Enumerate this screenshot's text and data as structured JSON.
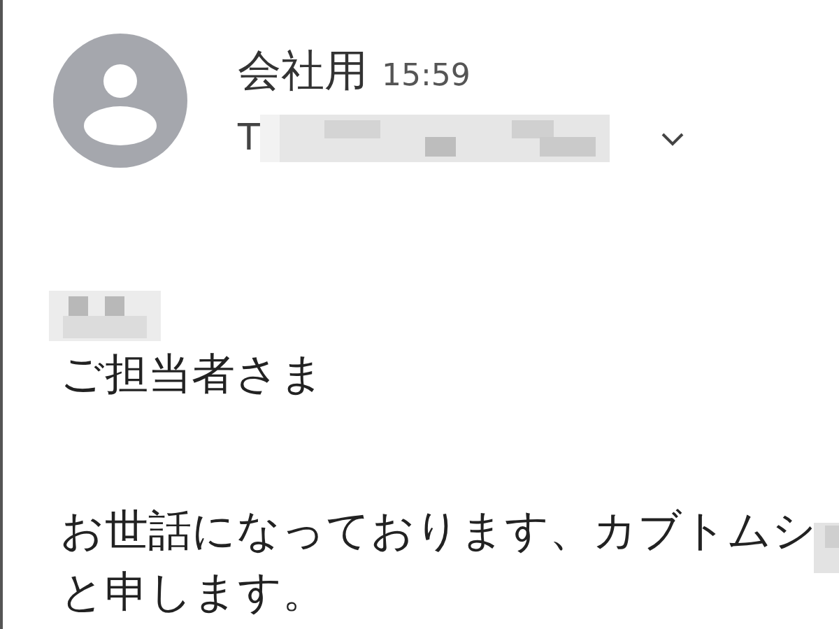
{
  "message": {
    "sender": "会社用",
    "time": "15:59",
    "recipient_prefix": "T",
    "greeting": "ご担当者さま",
    "paragraph": [
      "お世話になっております、カブトムシ",
      "と申します。"
    ]
  }
}
